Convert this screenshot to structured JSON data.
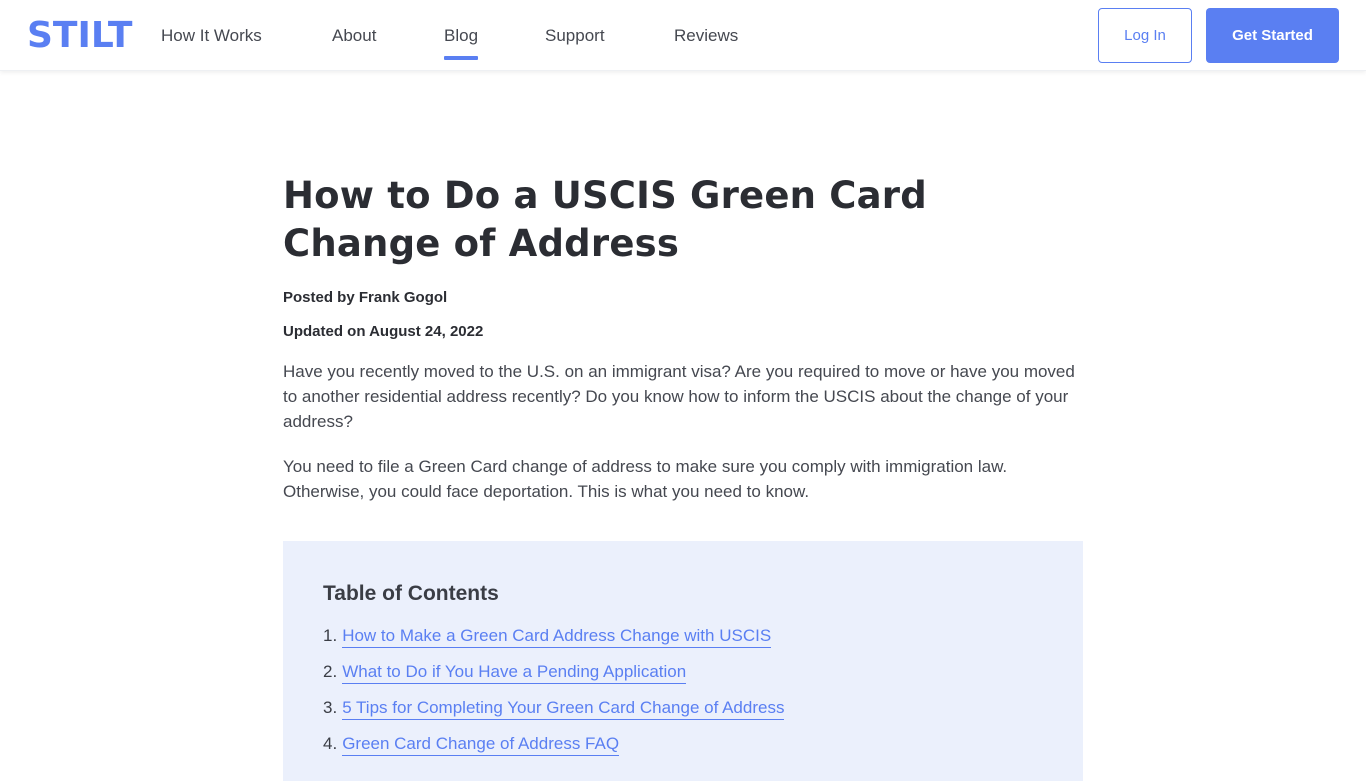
{
  "brand": {
    "logo_text": "STILT",
    "accent_color": "#5a7ff2"
  },
  "nav": {
    "items": [
      {
        "label": "How It Works",
        "active": false
      },
      {
        "label": "About",
        "active": false
      },
      {
        "label": "Blog",
        "active": true
      },
      {
        "label": "Support",
        "active": false
      },
      {
        "label": "Reviews",
        "active": false
      }
    ],
    "login_label": "Log In",
    "get_started_label": "Get Started"
  },
  "article": {
    "title": "How to Do a USCIS Green Card Change of Address",
    "posted_by": "Posted by Frank Gogol",
    "updated_on": "Updated on August 24, 2022",
    "paragraphs": [
      "Have you recently moved to the U.S. on an immigrant visa? Are you required to move or have you moved to another residential address recently? Do you know how to inform the USCIS about the change of your address?",
      "You need to file a Green Card change of address to make sure you comply with immigration law. Otherwise, you could face deportation. This is what you need to know."
    ]
  },
  "toc": {
    "title": "Table of Contents",
    "items": [
      {
        "number": "1.",
        "label": "How to Make a Green Card Address Change with USCIS"
      },
      {
        "number": "2.",
        "label": "What to Do if You Have a Pending Application"
      },
      {
        "number": "3.",
        "label": "5 Tips for Completing Your Green Card Change of Address"
      },
      {
        "number": "4.",
        "label": "Green Card Change of Address FAQ"
      }
    ]
  }
}
